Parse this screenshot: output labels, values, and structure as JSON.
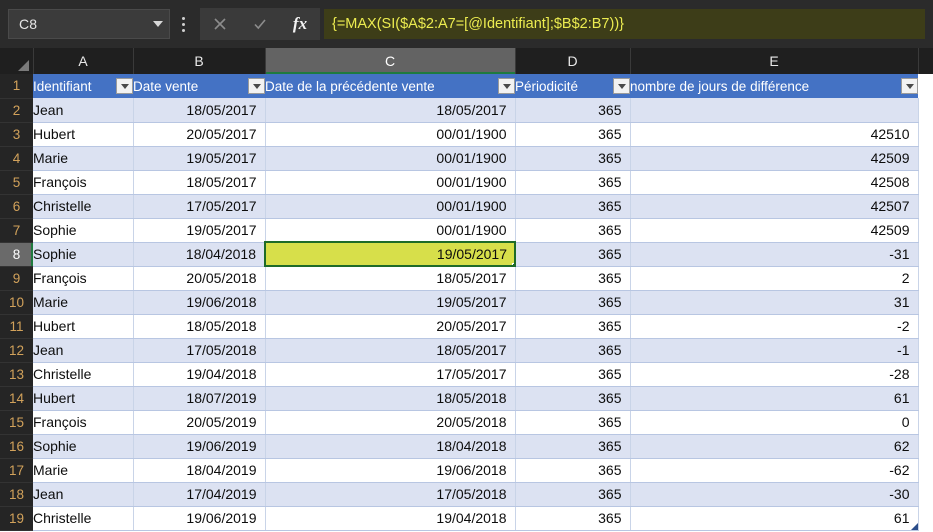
{
  "app": "excel-spreadsheet",
  "formula_bar": {
    "name_box_value": "C8",
    "name_box_caret_icon": "chevron-down-icon",
    "options_icon": "kebab-menu-icon",
    "cancel_icon": "close-icon",
    "confirm_icon": "check-icon",
    "function_icon": "fx-icon",
    "function_label": "fx",
    "formula": "{=MAX(SI($A$2:A7=[@Identifiant];$B$2:B7))}",
    "formula_text_color": "#ecec50",
    "formula_bg_color": "#3d3d18"
  },
  "grid": {
    "corner_icon": "select-all-triangle-icon",
    "column_letters": [
      "A",
      "B",
      "C",
      "D",
      "E"
    ],
    "selected_column": "C",
    "selected_row": "8",
    "selected_cell": "C8",
    "row_numbers": [
      "1",
      "2",
      "3",
      "4",
      "5",
      "6",
      "7",
      "8",
      "9",
      "10",
      "11",
      "12",
      "13",
      "14",
      "15",
      "16",
      "17",
      "18",
      "19"
    ],
    "selection_fill_color": "#d7df4a",
    "selection_border_color": "#1e6b28",
    "header_fill_color": "#4472c4",
    "band_fill_color": "#dce2f2"
  },
  "table": {
    "headers": [
      {
        "label": "Identifiant",
        "filter_icon": "filter-dropdown-icon"
      },
      {
        "label": "Date vente",
        "filter_icon": "filter-dropdown-icon"
      },
      {
        "label": "Date de la précédente vente",
        "filter_icon": "filter-dropdown-icon"
      },
      {
        "label": "Périodicité",
        "filter_icon": "filter-dropdown-icon"
      },
      {
        "label": "nombre de jours de différence",
        "filter_icon": "filter-dropdown-icon"
      }
    ],
    "rows": [
      {
        "row": "2",
        "identifiant": "Jean",
        "date_vente": "18/05/2017",
        "date_precedente": "18/05/2017",
        "periodicite": "365",
        "jours_difference": ""
      },
      {
        "row": "3",
        "identifiant": "Hubert",
        "date_vente": "20/05/2017",
        "date_precedente": "00/01/1900",
        "periodicite": "365",
        "jours_difference": "42510"
      },
      {
        "row": "4",
        "identifiant": "Marie",
        "date_vente": "19/05/2017",
        "date_precedente": "00/01/1900",
        "periodicite": "365",
        "jours_difference": "42509"
      },
      {
        "row": "5",
        "identifiant": "François",
        "date_vente": "18/05/2017",
        "date_precedente": "00/01/1900",
        "periodicite": "365",
        "jours_difference": "42508"
      },
      {
        "row": "6",
        "identifiant": "Christelle",
        "date_vente": "17/05/2017",
        "date_precedente": "00/01/1900",
        "periodicite": "365",
        "jours_difference": "42507"
      },
      {
        "row": "7",
        "identifiant": "Sophie",
        "date_vente": "19/05/2017",
        "date_precedente": "00/01/1900",
        "periodicite": "365",
        "jours_difference": "42509"
      },
      {
        "row": "8",
        "identifiant": "Sophie",
        "date_vente": "18/04/2018",
        "date_precedente": "19/05/2017",
        "periodicite": "365",
        "jours_difference": "-31"
      },
      {
        "row": "9",
        "identifiant": "François",
        "date_vente": "20/05/2018",
        "date_precedente": "18/05/2017",
        "periodicite": "365",
        "jours_difference": "2"
      },
      {
        "row": "10",
        "identifiant": "Marie",
        "date_vente": "19/06/2018",
        "date_precedente": "19/05/2017",
        "periodicite": "365",
        "jours_difference": "31"
      },
      {
        "row": "11",
        "identifiant": "Hubert",
        "date_vente": "18/05/2018",
        "date_precedente": "20/05/2017",
        "periodicite": "365",
        "jours_difference": "-2"
      },
      {
        "row": "12",
        "identifiant": "Jean",
        "date_vente": "17/05/2018",
        "date_precedente": "18/05/2017",
        "periodicite": "365",
        "jours_difference": "-1"
      },
      {
        "row": "13",
        "identifiant": "Christelle",
        "date_vente": "19/04/2018",
        "date_precedente": "17/05/2017",
        "periodicite": "365",
        "jours_difference": "-28"
      },
      {
        "row": "14",
        "identifiant": "Hubert",
        "date_vente": "18/07/2019",
        "date_precedente": "18/05/2018",
        "periodicite": "365",
        "jours_difference": "61"
      },
      {
        "row": "15",
        "identifiant": "François",
        "date_vente": "20/05/2019",
        "date_precedente": "20/05/2018",
        "periodicite": "365",
        "jours_difference": "0"
      },
      {
        "row": "16",
        "identifiant": "Sophie",
        "date_vente": "19/06/2019",
        "date_precedente": "18/04/2018",
        "periodicite": "365",
        "jours_difference": "62"
      },
      {
        "row": "17",
        "identifiant": "Marie",
        "date_vente": "18/04/2019",
        "date_precedente": "19/06/2018",
        "periodicite": "365",
        "jours_difference": "-62"
      },
      {
        "row": "18",
        "identifiant": "Jean",
        "date_vente": "17/04/2019",
        "date_precedente": "17/05/2018",
        "periodicite": "365",
        "jours_difference": "-30"
      },
      {
        "row": "19",
        "identifiant": "Christelle",
        "date_vente": "19/06/2019",
        "date_precedente": "19/04/2018",
        "periodicite": "365",
        "jours_difference": "61"
      }
    ]
  }
}
